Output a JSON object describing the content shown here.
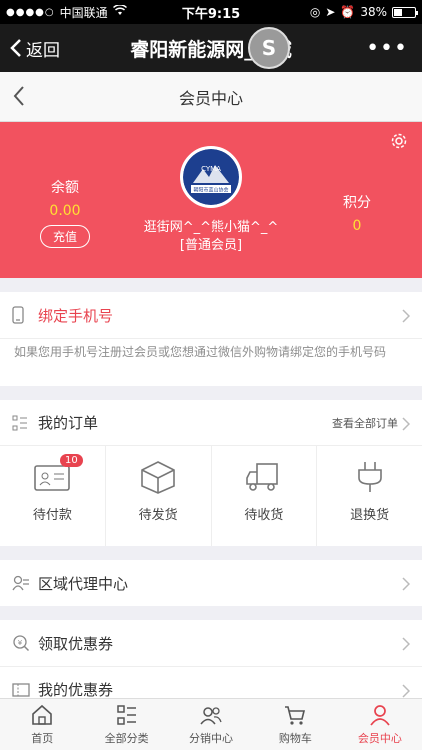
{
  "status": {
    "carrier": "中国联通",
    "time": "下午9:15",
    "battery": "38%"
  },
  "nav": {
    "back_label": "返回",
    "title": "睿阳新能源网_商城",
    "overlay_letter": "S"
  },
  "header": {
    "title": "会员中心"
  },
  "member": {
    "balance_label": "余额",
    "balance_value": "0.00",
    "recharge_label": "充值",
    "username": "逛街网^_^熊小猫^_^",
    "level": "[普通会员]",
    "points_label": "积分",
    "points_value": "0",
    "avatar_text": "CYMA",
    "avatar_subtext": "朝阳市蓝山协会"
  },
  "bind_phone": {
    "title": "绑定手机号",
    "description": "如果您用手机号注册过会员或您想通过微信外购物请绑定您的手机号码"
  },
  "orders": {
    "title": "我的订单",
    "view_all": "查看全部订单",
    "items": [
      {
        "label": "待付款",
        "icon": "wallet-icon",
        "badge": "10"
      },
      {
        "label": "待发货",
        "icon": "package-icon"
      },
      {
        "label": "待收货",
        "icon": "truck-icon"
      },
      {
        "label": "退换货",
        "icon": "plug-icon"
      }
    ]
  },
  "agent": {
    "title": "区域代理中心"
  },
  "coupons": {
    "get_title": "领取优惠券",
    "my_title": "我的优惠券"
  },
  "tabbar": {
    "items": [
      {
        "label": "首页",
        "icon": "home-icon"
      },
      {
        "label": "全部分类",
        "icon": "category-icon"
      },
      {
        "label": "分销中心",
        "icon": "distribution-icon"
      },
      {
        "label": "购物车",
        "icon": "cart-icon"
      },
      {
        "label": "会员中心",
        "icon": "member-icon",
        "active": true
      }
    ]
  },
  "colors": {
    "accent": "#e8434f",
    "banner": "#f2525f",
    "nav_bg": "#1b1b1b",
    "value_yellow": "#ffe033"
  }
}
